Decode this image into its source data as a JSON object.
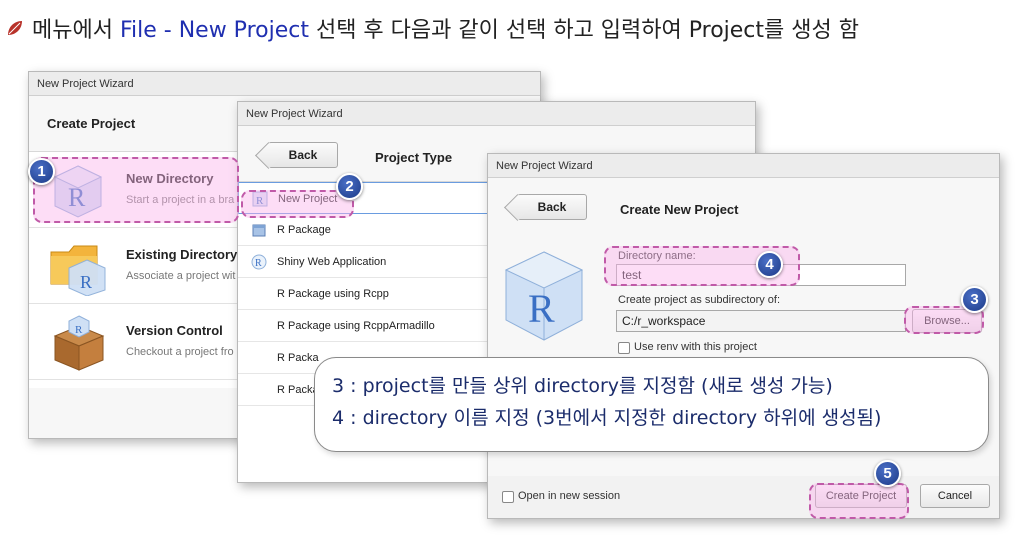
{
  "heading": {
    "prefix": "메뉴에서 ",
    "highlight": "File - New Project",
    "suffix": " 선택 후 다음과 같이 선택 하고 입력하여 Project를 생성 함"
  },
  "window1": {
    "title": "New Project Wizard",
    "header": "Create Project",
    "options": [
      {
        "title": "New Directory",
        "desc": "Start a project in a bra"
      },
      {
        "title": "Existing Directory",
        "desc": "Associate a project wit"
      },
      {
        "title": "Version Control",
        "desc": "Checkout a project fro"
      }
    ]
  },
  "window2": {
    "title": "New Project Wizard",
    "back_label": "Back",
    "header": "Project Type",
    "items": [
      "New Project",
      "R Package",
      "Shiny Web Application",
      "R Package using Rcpp",
      "R Package using RcppArmadillo",
      "R Packa",
      "R Packa"
    ]
  },
  "window3": {
    "title": "New Project Wizard",
    "back_label": "Back",
    "header": "Create New Project",
    "dir_label": "Directory name:",
    "dir_value": "test",
    "sub_label": "Create project as subdirectory of:",
    "sub_value": "C:/r_workspace",
    "browse_label": "Browse...",
    "renv_label": "Use renv with this project",
    "open_label": "Open in new session",
    "create_label": "Create Project",
    "cancel_label": "Cancel"
  },
  "badges": [
    "1",
    "2",
    "3",
    "4",
    "5"
  ],
  "note": {
    "line1": "3 : project를 만들 상위 directory를 지정함 (새로 생성 가능)",
    "line2": "4 : directory 이름 지정 (3번에서 지정한 directory 하위에 생성됨)"
  },
  "colors": {
    "highlight_blue": "#1f2fb0",
    "annotation_pink": "#c05aa8",
    "badge_blue": "#1c3a86",
    "r_logo_blue": "#3a6fc4"
  }
}
